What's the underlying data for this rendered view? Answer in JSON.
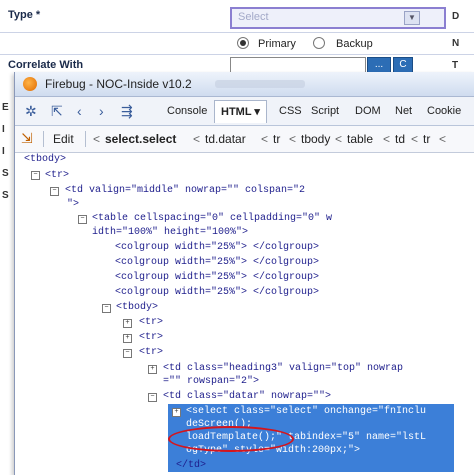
{
  "form": {
    "type_label": "Type *",
    "select_placeholder": "Select",
    "radio_primary": "Primary",
    "radio_backup": "Backup",
    "correlate_label": "Correlate With",
    "browse_button": "...",
    "clear_button": "C",
    "right_col_letters": [
      "D",
      "N",
      "T"
    ],
    "left_col_letters": [
      "E",
      "I",
      "I",
      "S",
      "S"
    ]
  },
  "firebug": {
    "title": "Firebug - NOC-Inside v10.2",
    "tabs": [
      "Console",
      "HTML ▾",
      "CSS",
      "Script",
      "DOM",
      "Net",
      "Cookie"
    ],
    "edit_label": "Edit",
    "breadcrumbs": [
      "select.select",
      "td.datar",
      "tr",
      "tbody",
      "table",
      "td",
      "tr"
    ]
  },
  "tree": {
    "lines": [
      "<tbody>",
      "<tr>",
      "<td valign=\"middle\" nowrap=\"\" colspan=\"2",
      "\">",
      "<table cellspacing=\"0\" cellpadding=\"0\" w",
      "idth=\"100%\" height=\"100%\">",
      "<colgroup width=\"25%\"> </colgroup>",
      "<colgroup width=\"25%\"> </colgroup>",
      "<colgroup width=\"25%\"> </colgroup>",
      "<colgroup width=\"25%\"> </colgroup>",
      "<tbody>",
      "<tr>",
      "<tr>",
      "<tr>",
      "<td class=\"heading3\" valign=\"top\" nowrap",
      "=\"\" rowspan=\"2\">",
      "<td class=\"datar\" nowrap=\"\">",
      "</td>"
    ],
    "selected_lines": [
      "<select class=\"select\" onchange=\"fnInclu",
      "deScreen();",
      "loadTemplate();\" tabindex=\"5\" name=\"lstL",
      "ogType\" style=\"width:200px;\">"
    ]
  },
  "colors": {
    "selection": "#3c7fd8",
    "highlight_oval": "#d4151c",
    "select_border": "#8b7fd1"
  }
}
